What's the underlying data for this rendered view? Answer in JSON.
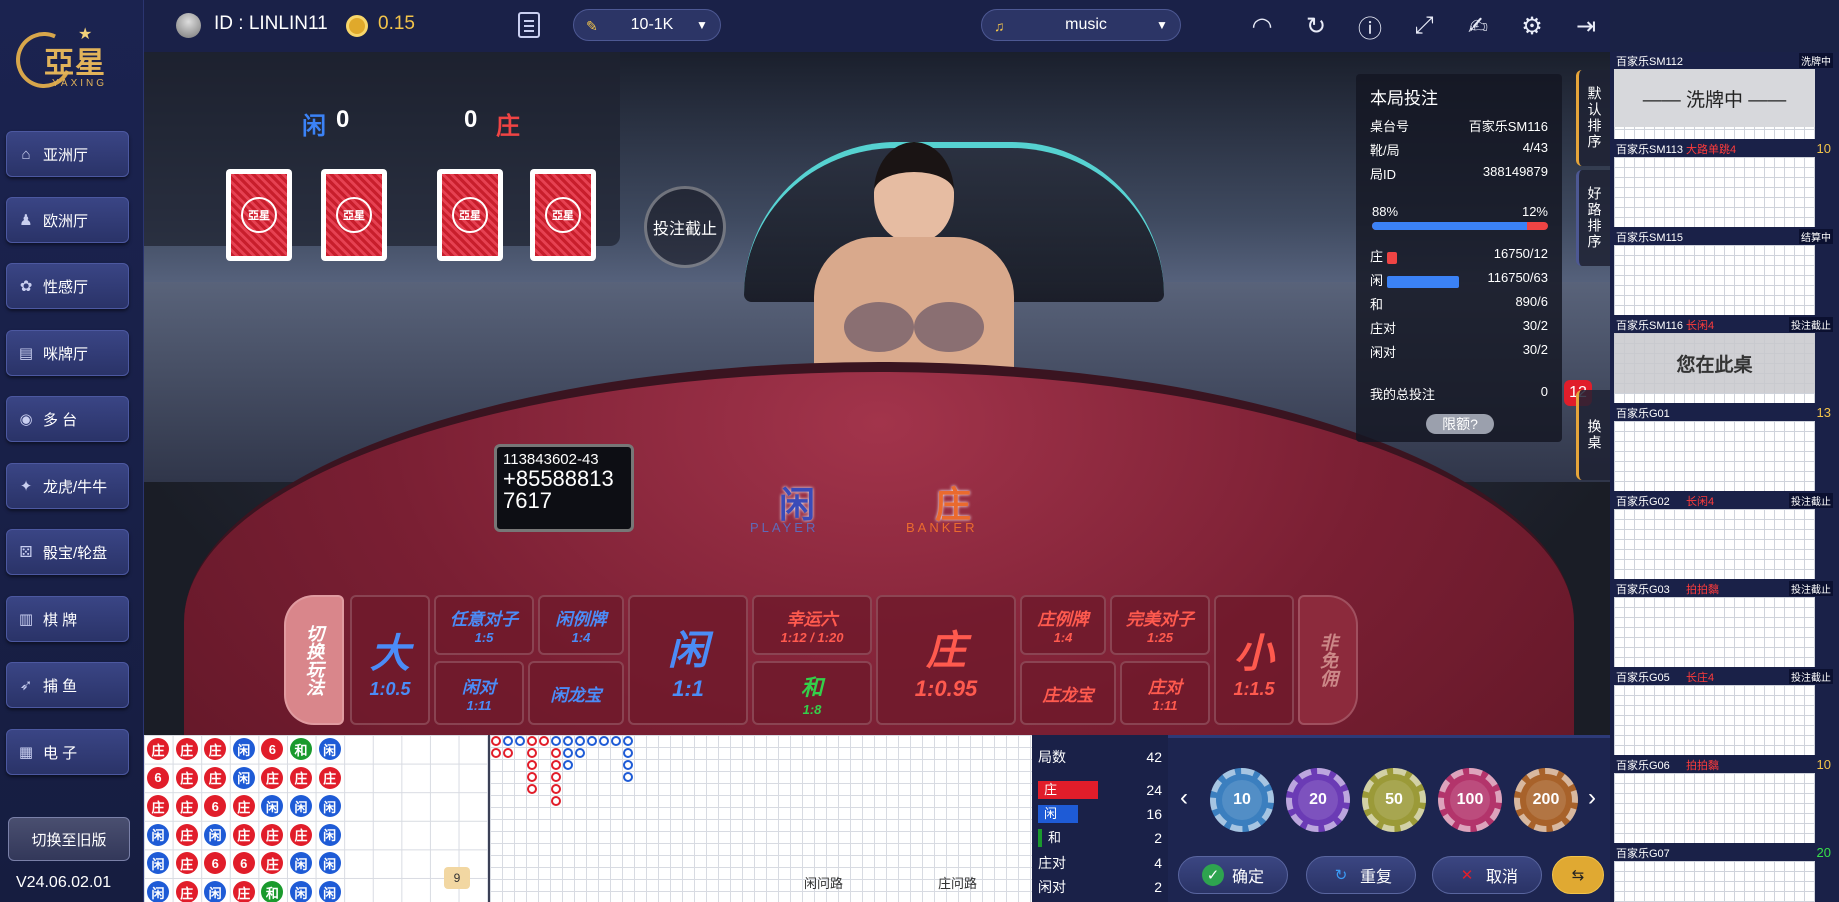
{
  "sidebar": {
    "logo_text": "亞星",
    "logo_sub": "YAXING",
    "items": [
      {
        "label": "亚洲厅",
        "icon": "home-icon"
      },
      {
        "label": "欧洲厅",
        "icon": "person-icon"
      },
      {
        "label": "性感厅",
        "icon": "lady-icon"
      },
      {
        "label": "咪牌厅",
        "icon": "cards-icon"
      },
      {
        "label": "多  台",
        "icon": "gamepad-icon"
      },
      {
        "label": "龙虎/牛牛",
        "icon": "dragon-icon"
      },
      {
        "label": "骰宝/轮盘",
        "icon": "dice-icon"
      },
      {
        "label": "棋  牌",
        "icon": "chess-icon"
      },
      {
        "label": "捕  鱼",
        "icon": "fish-icon"
      },
      {
        "label": "电  子",
        "icon": "slot-icon"
      }
    ],
    "switch_old": "切换至旧版",
    "version": "V24.06.02.01"
  },
  "topbar": {
    "user_id": "ID : LINLIN11",
    "balance": "0.15",
    "limit": "10-1K",
    "music": "music"
  },
  "cards": {
    "player_label": "闲",
    "player_score": "0",
    "banker_score": "0",
    "banker_label": "庄",
    "card_logo": "亞星",
    "bet_closed": "投注截止"
  },
  "table": {
    "phone_line1": "113843602-43",
    "phone_line2": "+85588813",
    "phone_line3": "7617",
    "player_zone": "闲",
    "player_en": "PLAYER",
    "banker_zone": "庄",
    "banker_en": "BANKER"
  },
  "bets": {
    "switch_play": "切换玩法",
    "big": {
      "name": "大",
      "odds": "1:0.5"
    },
    "any_pair": {
      "name": "任意对子",
      "odds": "1:5"
    },
    "player_pair": {
      "name": "闲对",
      "odds": "1:11"
    },
    "player_lucky": {
      "name": "闲例牌",
      "odds": "1:4"
    },
    "player_dragon": {
      "name": "闲龙宝"
    },
    "player": {
      "name": "闲",
      "odds": "1:1"
    },
    "lucky6": {
      "name": "幸运六",
      "odds": "1:12 / 1:20"
    },
    "tie": {
      "name": "和",
      "odds": "1:8"
    },
    "banker": {
      "name": "庄",
      "odds": "1:0.95"
    },
    "banker_lucky": {
      "name": "庄例牌",
      "odds": "1:4"
    },
    "banker_dragon": {
      "name": "庄龙宝"
    },
    "perfect_pair": {
      "name": "完美对子",
      "odds": "1:25"
    },
    "banker_pair": {
      "name": "庄对",
      "odds": "1:11"
    },
    "small": {
      "name": "小",
      "odds": "1:1.5"
    },
    "no_commission": "非免佣"
  },
  "bet_info": {
    "title": "本局投注",
    "rows": [
      {
        "k": "桌台号",
        "v": "百家乐SM116"
      },
      {
        "k": "靴/局",
        "v": "4/43"
      },
      {
        "k": "局ID",
        "v": "388149879"
      }
    ],
    "player_pct": "88%",
    "banker_pct": "12%",
    "player_fraction": 0.88,
    "totals": [
      {
        "k": "庄",
        "v": "16750/12"
      },
      {
        "k": "闲",
        "v": "116750/63"
      },
      {
        "k": "和",
        "v": "890/6"
      },
      {
        "k": "庄对",
        "v": "30/2"
      },
      {
        "k": "闲对",
        "v": "30/2"
      }
    ],
    "my_total_label": "我的总投注",
    "my_total": "0",
    "limit_btn": "限额?",
    "countdown": "12"
  },
  "side_tabs": {
    "default_sort": "默认排序",
    "good_road": "好路排序",
    "switch_table": "换桌"
  },
  "table_list": [
    {
      "name": "百家乐SM112",
      "status": "",
      "right": "洗牌中",
      "overlay": "—— 洗牌中 ——"
    },
    {
      "name": "百家乐SM113",
      "status": "大路单跳4",
      "right": "10",
      "overlay": ""
    },
    {
      "name": "百家乐SM115",
      "status": "",
      "right": "结算中",
      "overlay": ""
    },
    {
      "name": "百家乐SM116",
      "status": "长闲4",
      "right": "投注截止",
      "overlay": "您在此桌"
    },
    {
      "name": "百家乐G01",
      "status": "",
      "right": "13",
      "overlay": ""
    },
    {
      "name": "百家乐G02",
      "status": "长闲4",
      "right": "投注截止",
      "overlay": ""
    },
    {
      "name": "百家乐G03",
      "status": "拍拍黐",
      "right": "投注截止",
      "overlay": ""
    },
    {
      "name": "百家乐G05",
      "status": "长庄4",
      "right": "投注截止",
      "overlay": ""
    },
    {
      "name": "百家乐G06",
      "status": "拍拍黐",
      "right": "10",
      "overlay": ""
    },
    {
      "name": "百家乐G07",
      "status": "",
      "right": "20",
      "overlay": ""
    }
  ],
  "bead_road": [
    [
      "庄",
      "庄",
      "庄",
      "闲",
      "6",
      "和",
      "闲"
    ],
    [
      "6",
      "庄",
      "庄",
      "闲",
      "庄",
      "庄",
      "庄"
    ],
    [
      "庄",
      "庄",
      "6",
      "庄",
      "闲",
      "闲",
      "闲"
    ],
    [
      "闲",
      "庄",
      "闲",
      "庄",
      "庄",
      "庄",
      "闲"
    ],
    [
      "闲",
      "庄",
      "6",
      "6",
      "庄",
      "闲",
      "闲"
    ],
    [
      "闲",
      "庄",
      "闲",
      "庄",
      "和",
      "闲",
      "闲"
    ]
  ],
  "roads": {
    "player_ask": "闲问路",
    "banker_ask": "庄问路",
    "bead_count": "9"
  },
  "stats": {
    "rounds_label": "局数",
    "rounds": "42",
    "banker_label": "庄",
    "banker": "24",
    "player_label": "闲",
    "player": "16",
    "tie_label": "和",
    "tie": "2",
    "banker_pair_label": "庄对",
    "banker_pair": "4",
    "player_pair_label": "闲对",
    "player_pair": "2"
  },
  "chips": [
    "10",
    "20",
    "50",
    "100",
    "200"
  ],
  "actions": {
    "confirm": "确定",
    "repeat": "重复",
    "cancel": "取消"
  },
  "colors": {
    "banker": "#e11d2a",
    "player": "#1e5bd6",
    "tie": "#1a9a2d",
    "accent": "#f3c44a"
  }
}
